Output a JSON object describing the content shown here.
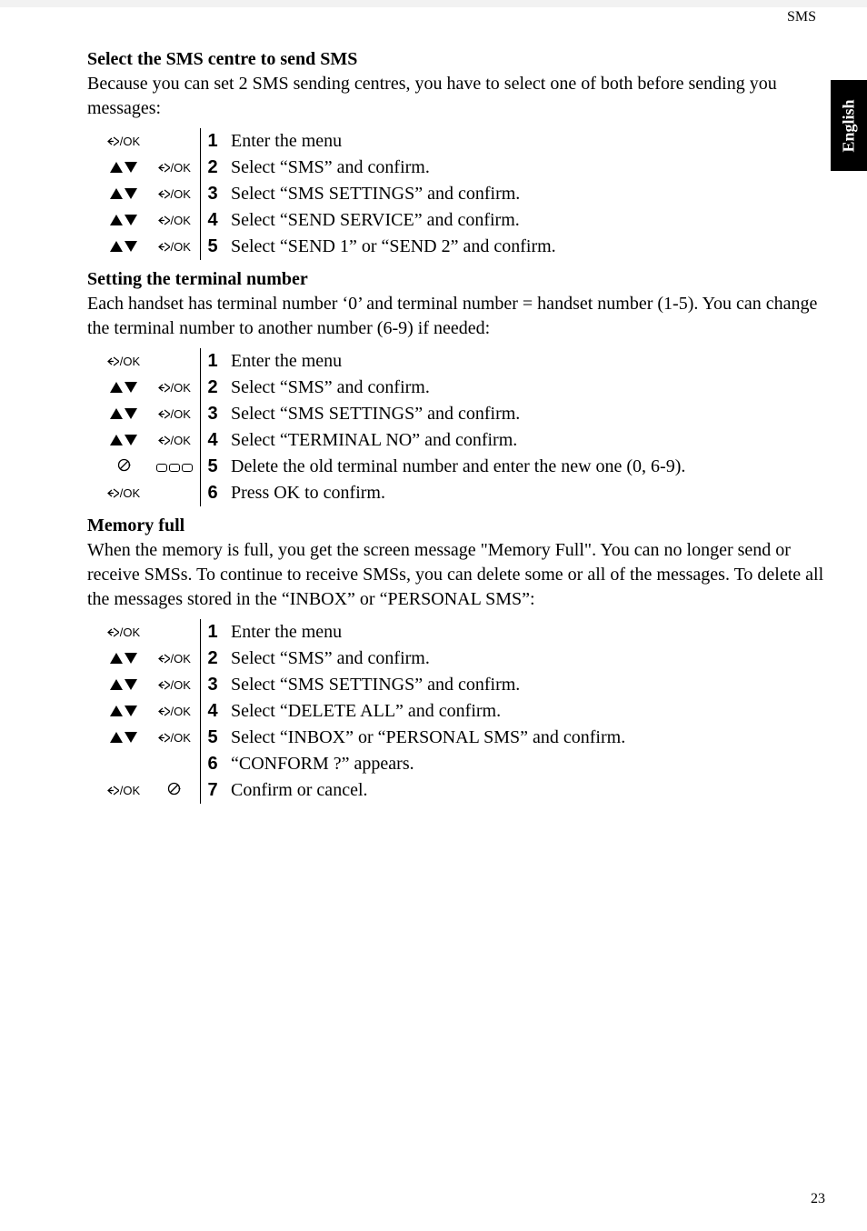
{
  "header": {
    "section_label": "SMS"
  },
  "side_tab": {
    "label": "English"
  },
  "sections": [
    {
      "title": "Select the SMS centre to send SMS",
      "intro": "Because you can set 2 SMS sending centres, you have to select one of both before sending you messages:",
      "steps": [
        {
          "n": "1",
          "text": "Enter the menu"
        },
        {
          "n": "2",
          "text": "Select “SMS” and confirm."
        },
        {
          "n": "3",
          "text": "Select “SMS SETTINGS” and confirm."
        },
        {
          "n": "4",
          "text": "Select “SEND SERVICE” and confirm."
        },
        {
          "n": "5",
          "text": "Select “SEND 1” or “SEND 2” and confirm."
        }
      ]
    },
    {
      "title": "Setting the terminal number",
      "intro": "Each handset has terminal number ‘0’ and terminal number = handset number (1-5). You can change the terminal number to another number (6-9) if needed:",
      "steps": [
        {
          "n": "1",
          "text": "Enter the menu"
        },
        {
          "n": "2",
          "text": "Select “SMS” and confirm."
        },
        {
          "n": "3",
          "text": "Select “SMS SETTINGS” and confirm."
        },
        {
          "n": "4",
          "text": "Select “TERMINAL NO” and confirm."
        },
        {
          "n": "5",
          "text": "Delete the old terminal number and enter the new one (0, 6-9)."
        },
        {
          "n": "6",
          "text": "Press OK to confirm."
        }
      ]
    },
    {
      "title": "Memory full",
      "intro": "When the memory is full, you get the screen message \"Memory Full\". You can no longer send or receive SMSs. To continue to receive SMSs, you can delete some or all of the messages. To delete all the messages stored in the “INBOX” or “PERSONAL SMS”:",
      "steps": [
        {
          "n": "1",
          "text": "Enter the menu"
        },
        {
          "n": "2",
          "text": "Select “SMS” and confirm."
        },
        {
          "n": "3",
          "text": "Select “SMS SETTINGS” and confirm."
        },
        {
          "n": "4",
          "text": "Select “DELETE ALL” and confirm."
        },
        {
          "n": "5",
          "text": "Select “INBOX” or “PERSONAL SMS” and confirm."
        },
        {
          "n": "6",
          "text": "“CONFORM ?” appears."
        },
        {
          "n": "7",
          "text": "Confirm or cancel."
        }
      ]
    }
  ],
  "page_number": "23"
}
